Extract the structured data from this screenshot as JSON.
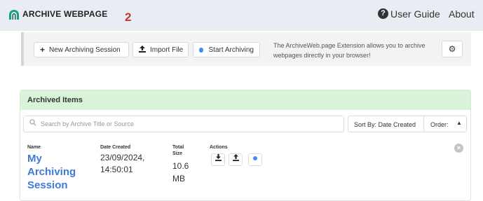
{
  "header": {
    "brand": "ARCHIVE WEBPAGE",
    "marker": "2",
    "guide_label": "User Guide",
    "about_label": "About"
  },
  "toolbar": {
    "new_session_label": "New Archiving Session",
    "import_label": "Import File",
    "start_label": "Start Archiving",
    "info_text": "The ArchiveWeb.page Extension allows you to archive webpages directly in your browser!"
  },
  "archive": {
    "title": "Archived Items",
    "search_placeholder": "Search by Archive Title or Source",
    "sort_label": "Sort By: Date Created",
    "order_label": "Order:",
    "columns": {
      "name": "Name",
      "date": "Date Created",
      "size": "Total Size",
      "actions": "Actions"
    },
    "items": [
      {
        "name": "My Archiving Session",
        "date": "23/09/2024, 14:50:01",
        "size": "10.6 MB"
      }
    ]
  },
  "icons": {
    "logo": "archive-arch-logo",
    "guide": "question-circle-icon",
    "new": "plus-icon",
    "import": "upload-icon",
    "start": "record-dot-icon",
    "settings": "gear-icon",
    "search": "search-icon",
    "sort": "chevron-down-icon",
    "order": "caret-up-icon",
    "download": "download-icon",
    "upload": "upload-icon",
    "remove": "close-circle-icon"
  },
  "colors": {
    "accent": "#3e8ef7",
    "link": "#3e7ad8",
    "header_bg": "#e9ecf3",
    "archive_header_bg": "#d9f4d9",
    "marker": "#c0392b"
  }
}
